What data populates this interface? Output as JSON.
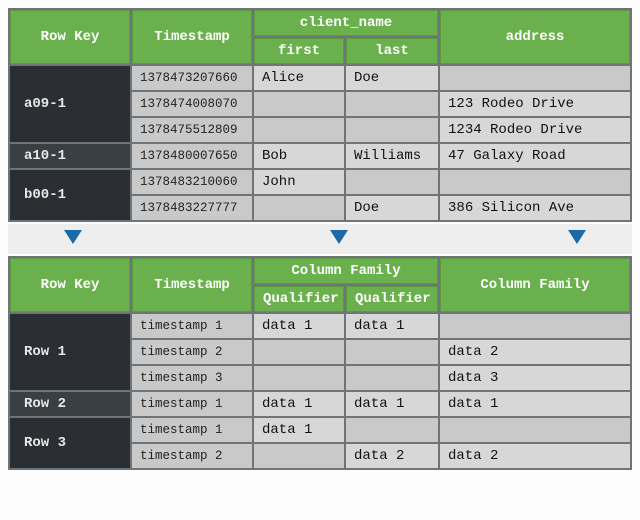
{
  "top": {
    "headers": {
      "rowkey": "Row Key",
      "timestamp": "Timestamp",
      "family1": "client_name",
      "qual1": "first",
      "qual2": "last",
      "family2": "address"
    },
    "rows": [
      {
        "key": "a09-1",
        "alt": false,
        "cells": [
          {
            "ts": "1378473207660",
            "first": "Alice",
            "last": "Doe",
            "address": ""
          },
          {
            "ts": "1378474008070",
            "first": "",
            "last": "",
            "address": "123 Rodeo Drive"
          },
          {
            "ts": "1378475512809",
            "first": "",
            "last": "",
            "address": "1234 Rodeo Drive"
          }
        ]
      },
      {
        "key": "a10-1",
        "alt": true,
        "cells": [
          {
            "ts": "1378480007650",
            "first": "Bob",
            "last": "Williams",
            "address": "47 Galaxy Road"
          }
        ]
      },
      {
        "key": "b00-1",
        "alt": false,
        "cells": [
          {
            "ts": "1378483210060",
            "first": "John",
            "last": "",
            "address": ""
          },
          {
            "ts": "1378483227777",
            "first": "",
            "last": "Doe",
            "address": "386 Silicon Ave"
          }
        ]
      }
    ]
  },
  "bottom": {
    "headers": {
      "rowkey": "Row Key",
      "timestamp": "Timestamp",
      "family1": "Column Family",
      "qual1": "Qualifier",
      "qual2": "Qualifier",
      "family2": "Column Family"
    },
    "rows": [
      {
        "key": "Row 1",
        "alt": false,
        "cells": [
          {
            "ts": "timestamp 1",
            "first": "data 1",
            "last": "data 1",
            "address": ""
          },
          {
            "ts": "timestamp 2",
            "first": "",
            "last": "",
            "address": "data 2"
          },
          {
            "ts": "timestamp 3",
            "first": "",
            "last": "",
            "address": "data 3"
          }
        ]
      },
      {
        "key": "Row 2",
        "alt": true,
        "cells": [
          {
            "ts": "timestamp 1",
            "first": "data 1",
            "last": "data 1",
            "address": "data 1"
          }
        ]
      },
      {
        "key": "Row 3",
        "alt": false,
        "cells": [
          {
            "ts": "timestamp 1",
            "first": "data 1",
            "last": "",
            "address": ""
          },
          {
            "ts": "timestamp 2",
            "first": "",
            "last": "data 2",
            "address": "data 2"
          }
        ]
      }
    ]
  }
}
